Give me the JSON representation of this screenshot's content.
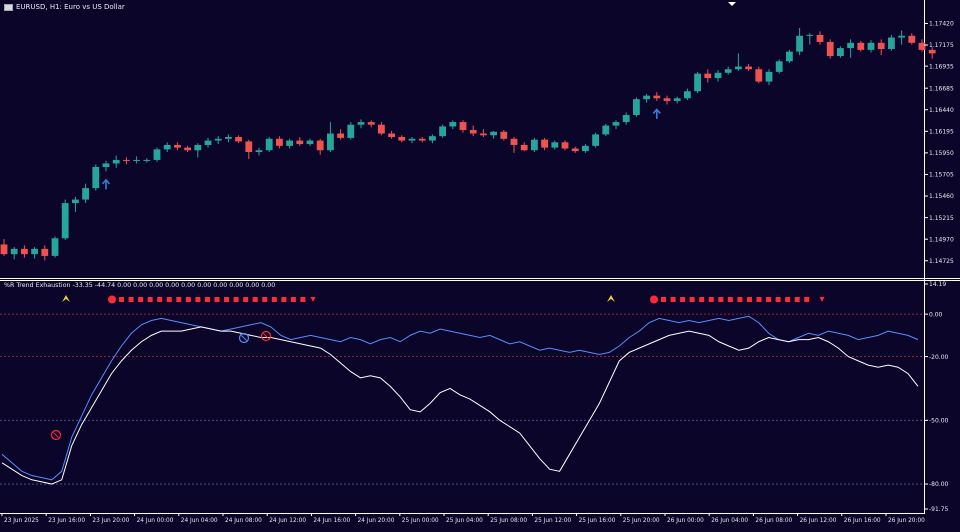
{
  "window": {
    "symbol_title": "EURUSD, H1:  Euro vs US Dollar",
    "indicator_title": "%R Trend Exhaustion -33.35 -44.74 0.00 0.00 0.00 0.00 0.00 0.00 0.00 0.00 0.00 0.00"
  },
  "colors": {
    "background": "#0b0529",
    "bull_candle": "#26a69a",
    "bear_candle": "#ef5350",
    "fast_line": "#5a8cff",
    "slow_line": "#ffffff",
    "level_red": "#c8283c",
    "level_blue": "#4a5a9a",
    "signal_red": "#ff2a3a",
    "signal_yellow": "#e8d040",
    "arrow_blue": "#3a7bd5",
    "axis_text": "#e8e8f0"
  },
  "price_axis": [
    "1.17420",
    "1.17175",
    "1.16935",
    "1.16685",
    "1.16440",
    "1.16195",
    "1.15950",
    "1.15705",
    "1.15460",
    "1.15215",
    "1.14970",
    "1.14725"
  ],
  "indicator_axis": [
    "14.19",
    "0.00",
    "-20.00",
    "-50.00",
    "-80.00",
    "-91.75"
  ],
  "time_axis": [
    "23 Jun 2025",
    "23 Jun 16:00",
    "23 Jun 20:00",
    "24 Jun 00:00",
    "24 Jun 04:00",
    "24 Jun 08:00",
    "24 Jun 12:00",
    "24 Jun 16:00",
    "24 Jun 20:00",
    "25 Jun 00:00",
    "25 Jun 04:00",
    "25 Jun 08:00",
    "25 Jun 12:00",
    "25 Jun 16:00",
    "25 Jun 20:00",
    "26 Jun 00:00",
    "26 Jun 04:00",
    "26 Jun 08:00",
    "26 Jun 12:00",
    "26 Jun 16:00",
    "26 Jun 20:00"
  ],
  "chart_data": {
    "type": "candlestick",
    "price_ylim": [
      1.1462,
      1.1755
    ],
    "candles": [
      [
        1.1491,
        1.1497,
        1.1478,
        1.148
      ],
      [
        1.148,
        1.1488,
        1.1474,
        1.1486
      ],
      [
        1.1486,
        1.149,
        1.1476,
        1.148
      ],
      [
        1.148,
        1.1488,
        1.1475,
        1.1486
      ],
      [
        1.1486,
        1.149,
        1.1473,
        1.1478
      ],
      [
        1.1478,
        1.15,
        1.1476,
        1.1498
      ],
      [
        1.1498,
        1.1542,
        1.1496,
        1.1538
      ],
      [
        1.1538,
        1.1545,
        1.1528,
        1.1542
      ],
      [
        1.1542,
        1.156,
        1.1538,
        1.1555
      ],
      [
        1.1555,
        1.1582,
        1.1552,
        1.1579
      ],
      [
        1.1579,
        1.1586,
        1.1574,
        1.1583
      ],
      [
        1.1583,
        1.1592,
        1.1578,
        1.1587
      ],
      [
        1.1587,
        1.159,
        1.1582,
        1.1586
      ],
      [
        1.1586,
        1.1591,
        1.1583,
        1.1587
      ],
      [
        1.1587,
        1.1589,
        1.1584,
        1.1587
      ],
      [
        1.1587,
        1.1601,
        1.1585,
        1.1599
      ],
      [
        1.1599,
        1.1607,
        1.1596,
        1.1604
      ],
      [
        1.1604,
        1.1607,
        1.1598,
        1.1601
      ],
      [
        1.1601,
        1.1603,
        1.1596,
        1.1598
      ],
      [
        1.1598,
        1.1606,
        1.159,
        1.1604
      ],
      [
        1.1604,
        1.1612,
        1.1601,
        1.1609
      ],
      [
        1.1609,
        1.1614,
        1.1605,
        1.1611
      ],
      [
        1.1611,
        1.1616,
        1.1607,
        1.1613
      ],
      [
        1.1613,
        1.1615,
        1.1606,
        1.1608
      ],
      [
        1.1608,
        1.161,
        1.1588,
        1.1596
      ],
      [
        1.1596,
        1.1601,
        1.1592,
        1.1598
      ],
      [
        1.1598,
        1.1613,
        1.1596,
        1.1611
      ],
      [
        1.1611,
        1.1614,
        1.16,
        1.1603
      ],
      [
        1.1603,
        1.1611,
        1.16,
        1.1609
      ],
      [
        1.1609,
        1.1613,
        1.1603,
        1.1605
      ],
      [
        1.1605,
        1.1611,
        1.1603,
        1.1609
      ],
      [
        1.1609,
        1.1611,
        1.1593,
        1.1598
      ],
      [
        1.1598,
        1.163,
        1.1596,
        1.1617
      ],
      [
        1.1617,
        1.1622,
        1.161,
        1.1612
      ],
      [
        1.1612,
        1.163,
        1.161,
        1.1627
      ],
      [
        1.1627,
        1.1633,
        1.1623,
        1.163
      ],
      [
        1.163,
        1.1632,
        1.1624,
        1.1627
      ],
      [
        1.1627,
        1.163,
        1.1615,
        1.1617
      ],
      [
        1.1617,
        1.162,
        1.1611,
        1.1613
      ],
      [
        1.1613,
        1.1615,
        1.1607,
        1.1609
      ],
      [
        1.1609,
        1.1613,
        1.1606,
        1.1611
      ],
      [
        1.1611,
        1.1613,
        1.1607,
        1.1609
      ],
      [
        1.1609,
        1.1616,
        1.1606,
        1.1614
      ],
      [
        1.1614,
        1.1627,
        1.1612,
        1.1625
      ],
      [
        1.1625,
        1.1632,
        1.1622,
        1.163
      ],
      [
        1.163,
        1.1632,
        1.1618,
        1.1621
      ],
      [
        1.1621,
        1.1626,
        1.1614,
        1.1617
      ],
      [
        1.1617,
        1.1622,
        1.1613,
        1.1615
      ],
      [
        1.1615,
        1.162,
        1.1611,
        1.1619
      ],
      [
        1.1619,
        1.1621,
        1.1609,
        1.1611
      ],
      [
        1.1611,
        1.1613,
        1.1595,
        1.1604
      ],
      [
        1.1604,
        1.1607,
        1.1597,
        1.1598
      ],
      [
        1.1598,
        1.1612,
        1.1596,
        1.161
      ],
      [
        1.161,
        1.1612,
        1.1598,
        1.1601
      ],
      [
        1.1601,
        1.1609,
        1.1599,
        1.1607
      ],
      [
        1.1607,
        1.1609,
        1.1598,
        1.16
      ],
      [
        1.16,
        1.1602,
        1.1595,
        1.1597
      ],
      [
        1.1597,
        1.1605,
        1.1595,
        1.1603
      ],
      [
        1.1603,
        1.1618,
        1.1601,
        1.1616
      ],
      [
        1.1616,
        1.1628,
        1.1614,
        1.1626
      ],
      [
        1.1626,
        1.1632,
        1.1622,
        1.163
      ],
      [
        1.163,
        1.1641,
        1.1627,
        1.1638
      ],
      [
        1.1638,
        1.1658,
        1.1636,
        1.1656
      ],
      [
        1.1656,
        1.1662,
        1.1652,
        1.166
      ],
      [
        1.166,
        1.1664,
        1.1654,
        1.1657
      ],
      [
        1.1657,
        1.166,
        1.165,
        1.1654
      ],
      [
        1.1654,
        1.1659,
        1.1651,
        1.1657
      ],
      [
        1.1657,
        1.1668,
        1.1655,
        1.1665
      ],
      [
        1.1665,
        1.1687,
        1.1663,
        1.1685
      ],
      [
        1.1685,
        1.169,
        1.1675,
        1.168
      ],
      [
        1.168,
        1.1689,
        1.1676,
        1.1686
      ],
      [
        1.1686,
        1.1693,
        1.1684,
        1.169
      ],
      [
        1.169,
        1.1708,
        1.1688,
        1.1693
      ],
      [
        1.1693,
        1.1696,
        1.1688,
        1.169
      ],
      [
        1.169,
        1.1693,
        1.1674,
        1.1676
      ],
      [
        1.1676,
        1.169,
        1.1672,
        1.1687
      ],
      [
        1.1687,
        1.1701,
        1.1685,
        1.1699
      ],
      [
        1.1699,
        1.1712,
        1.1697,
        1.171
      ],
      [
        1.171,
        1.1737,
        1.1706,
        1.1728
      ],
      [
        1.1728,
        1.1731,
        1.1718,
        1.1729
      ],
      [
        1.1729,
        1.1733,
        1.1718,
        1.1721
      ],
      [
        1.1721,
        1.1724,
        1.1702,
        1.1705
      ],
      [
        1.1705,
        1.1716,
        1.1703,
        1.1714
      ],
      [
        1.1714,
        1.1724,
        1.1703,
        1.172
      ],
      [
        1.172,
        1.1722,
        1.171,
        1.1712
      ],
      [
        1.1712,
        1.1723,
        1.1709,
        1.172
      ],
      [
        1.172,
        1.1724,
        1.1706,
        1.1713
      ],
      [
        1.1713,
        1.1729,
        1.1711,
        1.1726
      ],
      [
        1.1726,
        1.1734,
        1.1718,
        1.1728
      ],
      [
        1.1728,
        1.1731,
        1.1718,
        1.172
      ],
      [
        1.172,
        1.1724,
        1.171,
        1.1712
      ],
      [
        1.1712,
        1.1715,
        1.1702,
        1.1708
      ]
    ],
    "buy_arrows": [
      10,
      64
    ],
    "fast_line": [
      -66,
      -70,
      -74,
      -76,
      -77,
      -78,
      -74,
      -58,
      -48,
      -38,
      -30,
      -22,
      -15,
      -9,
      -5,
      -3,
      -2,
      -3,
      -4,
      -5,
      -6,
      -7,
      -8,
      -7,
      -6,
      -5,
      -4,
      -6,
      -10,
      -12,
      -11,
      -10,
      -11,
      -12,
      -13,
      -11,
      -12,
      -14,
      -12,
      -11,
      -13,
      -10,
      -8,
      -9,
      -7,
      -8,
      -9,
      -10,
      -11,
      -10,
      -12,
      -14,
      -13,
      -15,
      -17,
      -16,
      -17,
      -18,
      -17,
      -18,
      -19,
      -18,
      -15,
      -11,
      -8,
      -4,
      -2,
      -3,
      -4,
      -3,
      -4,
      -3,
      -2,
      -3,
      -2,
      -1,
      -4,
      -9,
      -12,
      -13,
      -11,
      -9,
      -10,
      -8,
      -9,
      -10,
      -12,
      -11,
      -10,
      -8,
      -9,
      -10,
      -12
    ],
    "slow_line": [
      -70,
      -73,
      -76,
      -78,
      -79,
      -80,
      -78,
      -62,
      -52,
      -44,
      -36,
      -28,
      -22,
      -17,
      -13,
      -10,
      -8,
      -8,
      -8,
      -7,
      -6,
      -7,
      -8,
      -8,
      -9,
      -10,
      -11,
      -11,
      -12,
      -13,
      -14,
      -15,
      -16,
      -19,
      -23,
      -27,
      -30,
      -29,
      -30,
      -34,
      -39,
      -45,
      -46,
      -42,
      -37,
      -35,
      -38,
      -40,
      -43,
      -46,
      -50,
      -53,
      -56,
      -62,
      -68,
      -73,
      -74,
      -66,
      -58,
      -50,
      -42,
      -32,
      -22,
      -18,
      -16,
      -14,
      -12,
      -10,
      -9,
      -8,
      -9,
      -10,
      -13,
      -15,
      -17,
      -16,
      -13,
      -11,
      -12,
      -13,
      -12,
      -12,
      -11,
      -13,
      -16,
      -20,
      -22,
      -24,
      -25,
      -24,
      -25,
      -28,
      -34
    ]
  }
}
